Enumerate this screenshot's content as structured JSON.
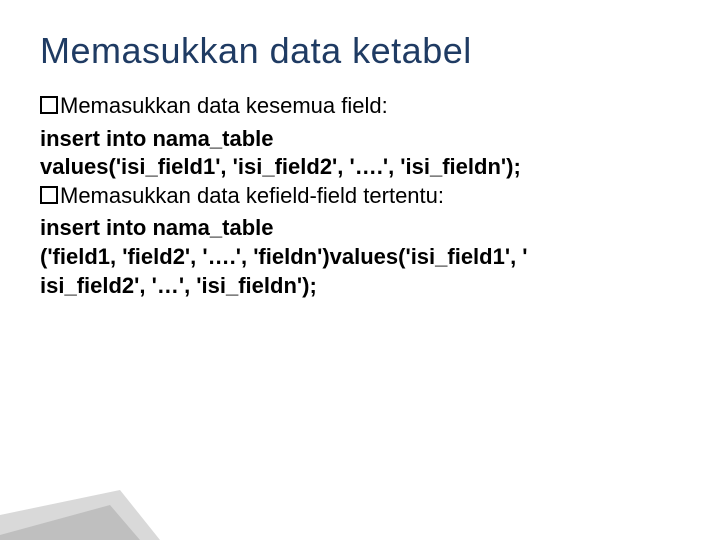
{
  "title": "Memasukkan data ketabel",
  "b1_lead": "Memasukkan",
  "b1_rest": " data kesemua field:",
  "code1a": "insert into nama_table",
  "code1b": "values('isi_field1', 'isi_field2', '….', 'isi_fieldn');",
  "b2_lead": "Memasukkan",
  "b2_rest": " data kefield-field tertentu:",
  "code2a": "insert into nama_table",
  "code2b": "('field1, 'field2', '….', 'fieldn')values('isi_field1', '",
  "code2c": "isi_field2', '…', 'isi_fieldn');"
}
